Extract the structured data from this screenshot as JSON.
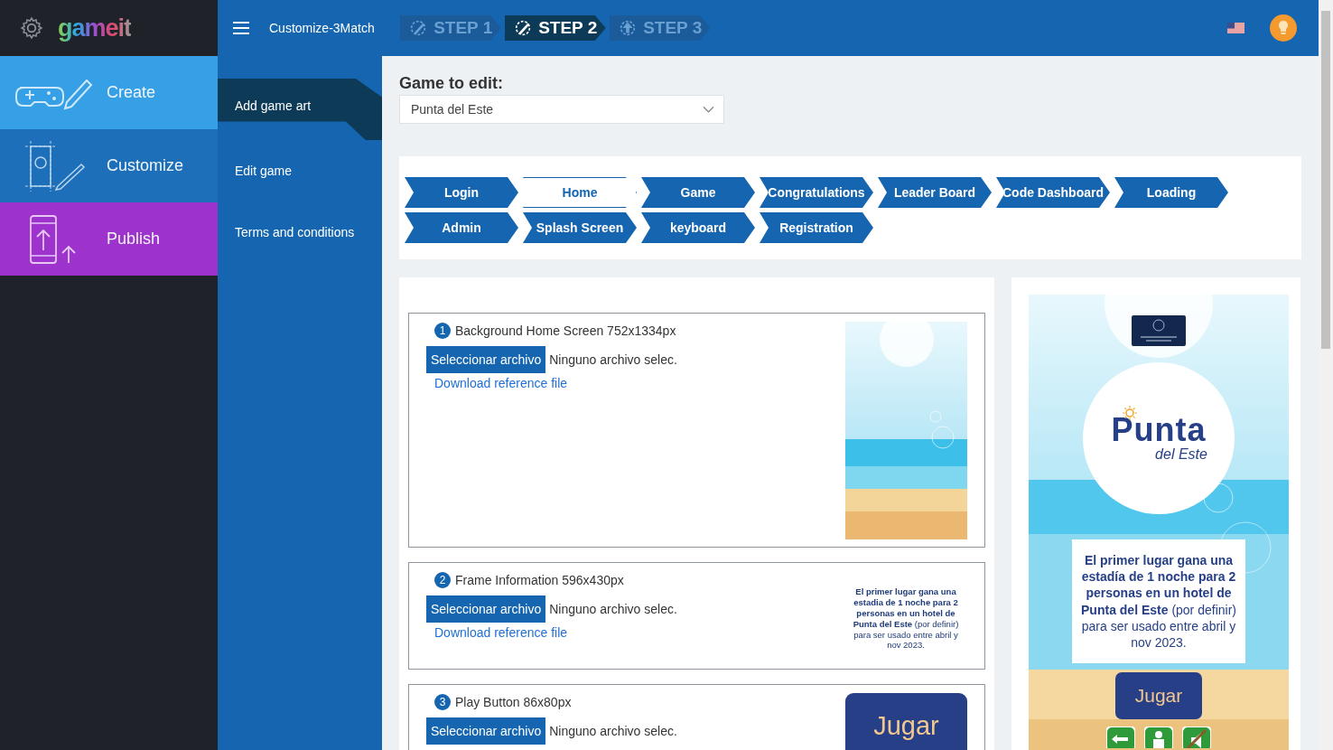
{
  "brand": {
    "logo": "gameit"
  },
  "main_nav": [
    {
      "label": "Create",
      "kind": "create",
      "color": "#36a0e6"
    },
    {
      "label": "Customize",
      "kind": "customize",
      "color": "#1c6fb8"
    },
    {
      "label": "Publish",
      "kind": "publish",
      "color": "#9d32cc"
    }
  ],
  "sub_nav": [
    {
      "label": "Add game art",
      "selected": true
    },
    {
      "label": "Edit game",
      "selected": false
    },
    {
      "label": "Terms and conditions",
      "selected": false
    }
  ],
  "topbar": {
    "project": "Customize-3Match",
    "steps": [
      {
        "label": "STEP 1",
        "kind": "edit",
        "selected": false
      },
      {
        "label": "STEP 2",
        "kind": "edit",
        "selected": true
      },
      {
        "label": "STEP 3",
        "kind": "upload",
        "selected": false
      }
    ]
  },
  "game_select": {
    "label": "Game to edit:",
    "value": "Punta del Este"
  },
  "screen_tabs": [
    {
      "label": "Login",
      "selected": false
    },
    {
      "label": "Home",
      "selected": true
    },
    {
      "label": "Game",
      "selected": false
    },
    {
      "label": "Congratulations",
      "selected": false
    },
    {
      "label": "Leader Board",
      "selected": false
    },
    {
      "label": "Code Dashboard",
      "selected": false
    },
    {
      "label": "Loading",
      "selected": false
    },
    {
      "label": "Admin",
      "selected": false
    },
    {
      "label": "Splash Screen",
      "selected": false
    },
    {
      "label": "keyboard",
      "selected": false
    },
    {
      "label": "Registration",
      "selected": false
    }
  ],
  "assets": [
    {
      "number": "1",
      "title": "Background Home Screen 752x1334px",
      "button": "Seleccionar archivo",
      "file_status": "Ninguno archivo selec.",
      "link": "Download reference file"
    },
    {
      "number": "2",
      "title": "Frame Information 596x430px",
      "button": "Seleccionar archivo",
      "file_status": "Ninguno archivo selec.",
      "link": "Download reference file",
      "preview": {
        "kind": "text",
        "text": "**El primer lugar gana una estadia de 1 noche para 2 personas en un hotel de Punta del Este** (por definir) para ser usado entre abril y nov 2023."
      }
    },
    {
      "number": "3",
      "title": "Play Button 86x80px",
      "button": "Seleccionar archivo",
      "file_status": "Ninguno archivo selec.",
      "preview": {
        "kind": "button",
        "label": "Jugar"
      }
    }
  ],
  "phone_preview": {
    "logo_main": "Punta",
    "logo_sub": "del Este",
    "message": "**El primer lugar gana una estadía de 1 noche para 2 personas en un hotel de Punta del Este** (por definir) para ser usado entre abril y nov 2023.",
    "play_button": "Jugar"
  }
}
